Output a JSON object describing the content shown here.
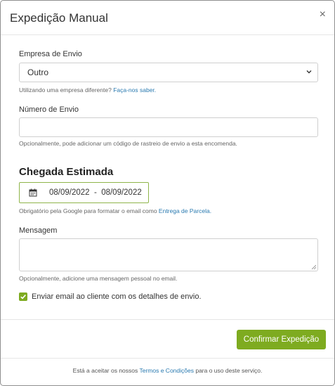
{
  "modal": {
    "title": "Expedição Manual",
    "close_label": "×"
  },
  "carrier": {
    "label": "Empresa de Envio",
    "selected": "Outro",
    "help_text": "Utilizando uma empresa diferente?",
    "help_link": "Faça-nos saber."
  },
  "tracking": {
    "label": "Número de Envio",
    "value": "",
    "help_text": "Opcionalmente, pode adicionar um código de rastreio de envio a esta encomenda."
  },
  "estimated_arrival": {
    "title": "Chegada Estimada",
    "date_from": "08/09/2022",
    "separator": "-",
    "date_to": "08/09/2022",
    "help_text": "Obrigatório pela Google para formatar o email como",
    "help_link": "Entrega de Parcela."
  },
  "message": {
    "label": "Mensagem",
    "value": "",
    "help_text": "Opcionalmente, adicione uma mensagem pessoal no email."
  },
  "notify": {
    "checked": true,
    "label": "Enviar email ao cliente com os detalhes de envio."
  },
  "actions": {
    "confirm_label": "Confirmar Expedição"
  },
  "footer": {
    "text_before": "Está a aceitar os nossos",
    "link": "Termos e Condições",
    "text_after": "para o uso deste serviço."
  },
  "colors": {
    "accent": "#7eab20",
    "link": "#2a7ab0"
  }
}
